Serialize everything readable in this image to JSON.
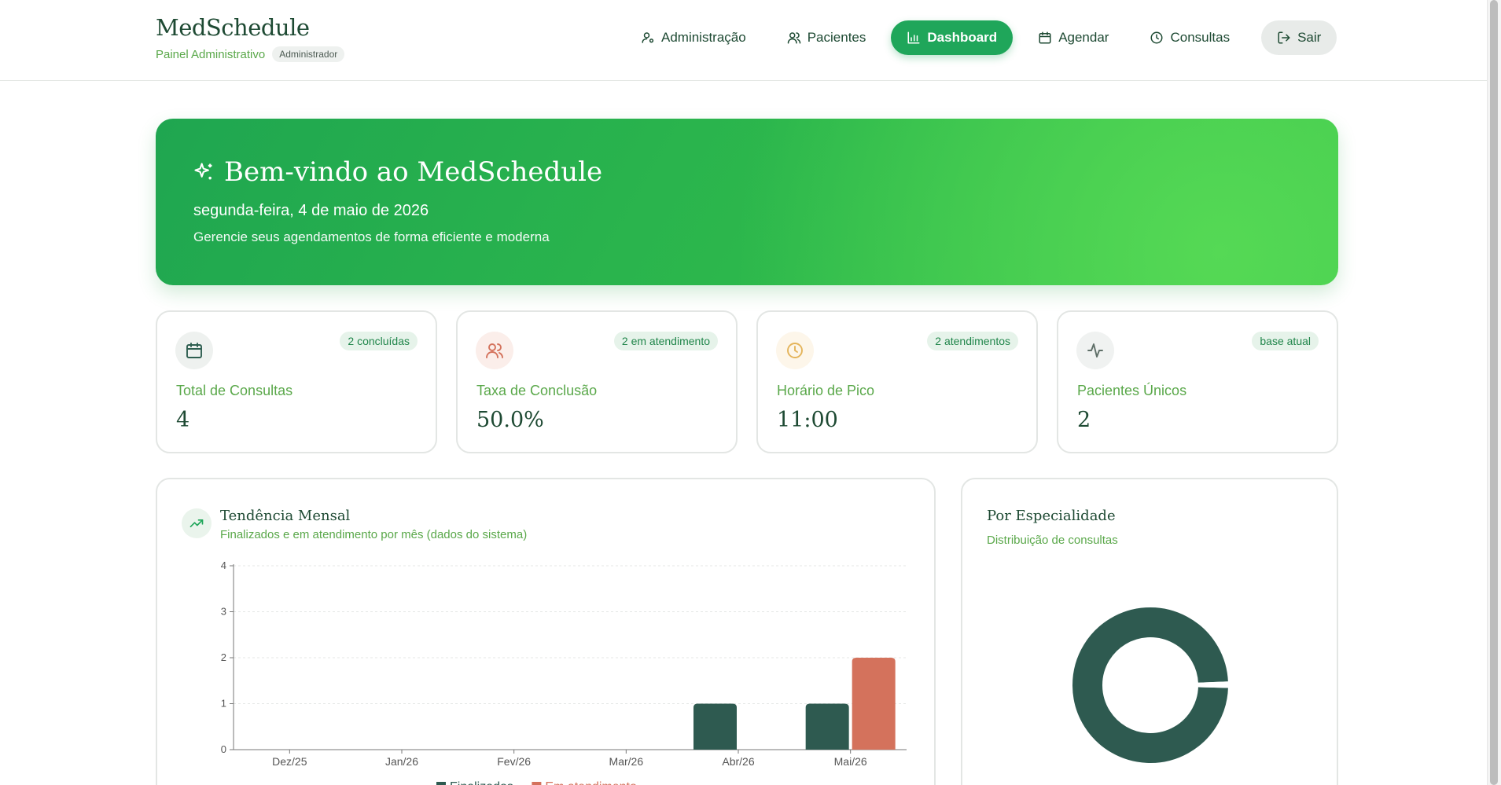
{
  "header": {
    "app_title": "MedSchedule",
    "subtitle": "Painel Administrativo",
    "role_badge": "Administrador",
    "nav": [
      {
        "label": "Administração",
        "icon": "user-cog-icon"
      },
      {
        "label": "Pacientes",
        "icon": "users-icon"
      },
      {
        "label": "Dashboard",
        "icon": "bar-chart-icon",
        "active": true
      },
      {
        "label": "Agendar",
        "icon": "calendar-icon"
      },
      {
        "label": "Consultas",
        "icon": "clock-icon"
      },
      {
        "label": "Sair",
        "icon": "logout-icon"
      }
    ]
  },
  "hero": {
    "title": "Bem-vindo ao MedSchedule",
    "date": "segunda-feira, 4 de maio de 2026",
    "description": "Gerencie seus agendamentos de forma eficiente e moderna"
  },
  "stats": [
    {
      "label": "Total de Consultas",
      "value": "4",
      "badge": "2 concluídas",
      "icon": "calendar-icon",
      "icon_color": "#2e5e50",
      "icon_bg": "#eef1ef"
    },
    {
      "label": "Taxa de Conclusão",
      "value": "50.0%",
      "badge": "2 em atendimento",
      "icon": "users-icon",
      "icon_color": "#d4725c",
      "icon_bg": "#fbeeea"
    },
    {
      "label": "Horário de Pico",
      "value": "11:00",
      "badge": "2 atendimentos",
      "icon": "clock-icon",
      "icon_color": "#e4b45a",
      "icon_bg": "#fdf6ea"
    },
    {
      "label": "Pacientes Únicos",
      "value": "2",
      "badge": "base atual",
      "icon": "activity-icon",
      "icon_color": "#5f6f68",
      "icon_bg": "#f0f2f1"
    }
  ],
  "trend_panel": {
    "title": "Tendência Mensal",
    "subtitle": "Finalizados e em atendimento por mês (dados do sistema)"
  },
  "specialty_panel": {
    "title": "Por Especialidade",
    "subtitle": "Distribuição de consultas"
  },
  "colors": {
    "primary": "#1fa65a",
    "finalized": "#2e5a50",
    "in_progress": "#d4725c"
  },
  "chart_data": [
    {
      "type": "bar",
      "categories": [
        "Dez/25",
        "Jan/26",
        "Fev/26",
        "Mar/26",
        "Abr/26",
        "Mai/26"
      ],
      "series": [
        {
          "name": "Finalizados",
          "values": [
            0,
            0,
            0,
            0,
            1,
            1
          ]
        },
        {
          "name": "Em atendimento",
          "values": [
            0,
            0,
            0,
            0,
            0,
            2
          ]
        }
      ],
      "ylim": [
        0,
        4
      ],
      "yticks": [
        0,
        1,
        2,
        3,
        4
      ],
      "grid": true,
      "legend": "bottom"
    },
    {
      "type": "pie",
      "style": "donut",
      "slices": [
        {
          "value": 99
        },
        {
          "value": 1
        }
      ]
    }
  ]
}
